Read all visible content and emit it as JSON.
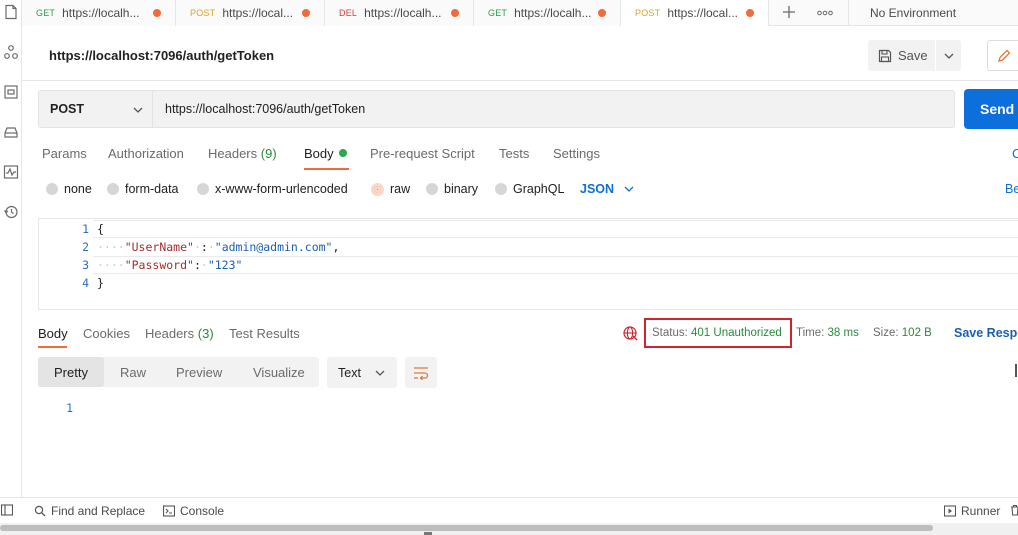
{
  "tabs": [
    {
      "method": "GET",
      "url": "https://localh..."
    },
    {
      "method": "POST",
      "url": "https://local..."
    },
    {
      "method": "DEL",
      "url": "https://localh..."
    },
    {
      "method": "GET",
      "url": "https://localh..."
    },
    {
      "method": "POST",
      "url": "https://local..."
    }
  ],
  "environment": "No Environment",
  "request": {
    "title": "https://localhost:7096/auth/getToken",
    "method": "POST",
    "url": "https://localhost:7096/auth/getToken",
    "save_label": "Save",
    "send_label": "Send"
  },
  "request_tabs": {
    "params": "Params",
    "authorization": "Authorization",
    "headers": "Headers",
    "headers_count": "(9)",
    "body": "Body",
    "prerequest": "Pre-request Script",
    "tests": "Tests",
    "settings": "Settings",
    "cookies_cut": "C"
  },
  "body_types": {
    "none": "none",
    "form_data": "form-data",
    "urlencoded": "x-www-form-urlencoded",
    "raw": "raw",
    "binary": "binary",
    "graphql": "GraphQL",
    "format": "JSON",
    "beautify_cut": "Be"
  },
  "editor": {
    "line_numbers": [
      "1",
      "2",
      "3",
      "4"
    ],
    "open_brace": "{",
    "close_brace": "}",
    "key1": "\"UserName\"",
    "val1": "\"admin@admin.com\"",
    "key2": "\"Password\"",
    "val2": "\"123\""
  },
  "response_tabs": {
    "body": "Body",
    "cookies": "Cookies",
    "headers": "Headers",
    "headers_count": "(3)",
    "test_results": "Test Results"
  },
  "response": {
    "status_label": "Status:",
    "status_value": "401 Unauthorized",
    "time_label": "Time:",
    "time_value": "38 ms",
    "size_label": "Size:",
    "size_value": "102 B",
    "save_response": "Save Respo"
  },
  "view_modes": {
    "pretty": "Pretty",
    "raw": "Raw",
    "preview": "Preview",
    "visualize": "Visualize",
    "text_format": "Text"
  },
  "response_body": {
    "line_numbers": [
      "1"
    ]
  },
  "footer": {
    "find_replace": "Find and Replace",
    "console": "Console",
    "runner": "Runner"
  },
  "colors": {
    "accent": "#f26b3a",
    "send": "#0c6fdc",
    "status_highlight": "#d0232a",
    "success": "#2a8a3e"
  }
}
